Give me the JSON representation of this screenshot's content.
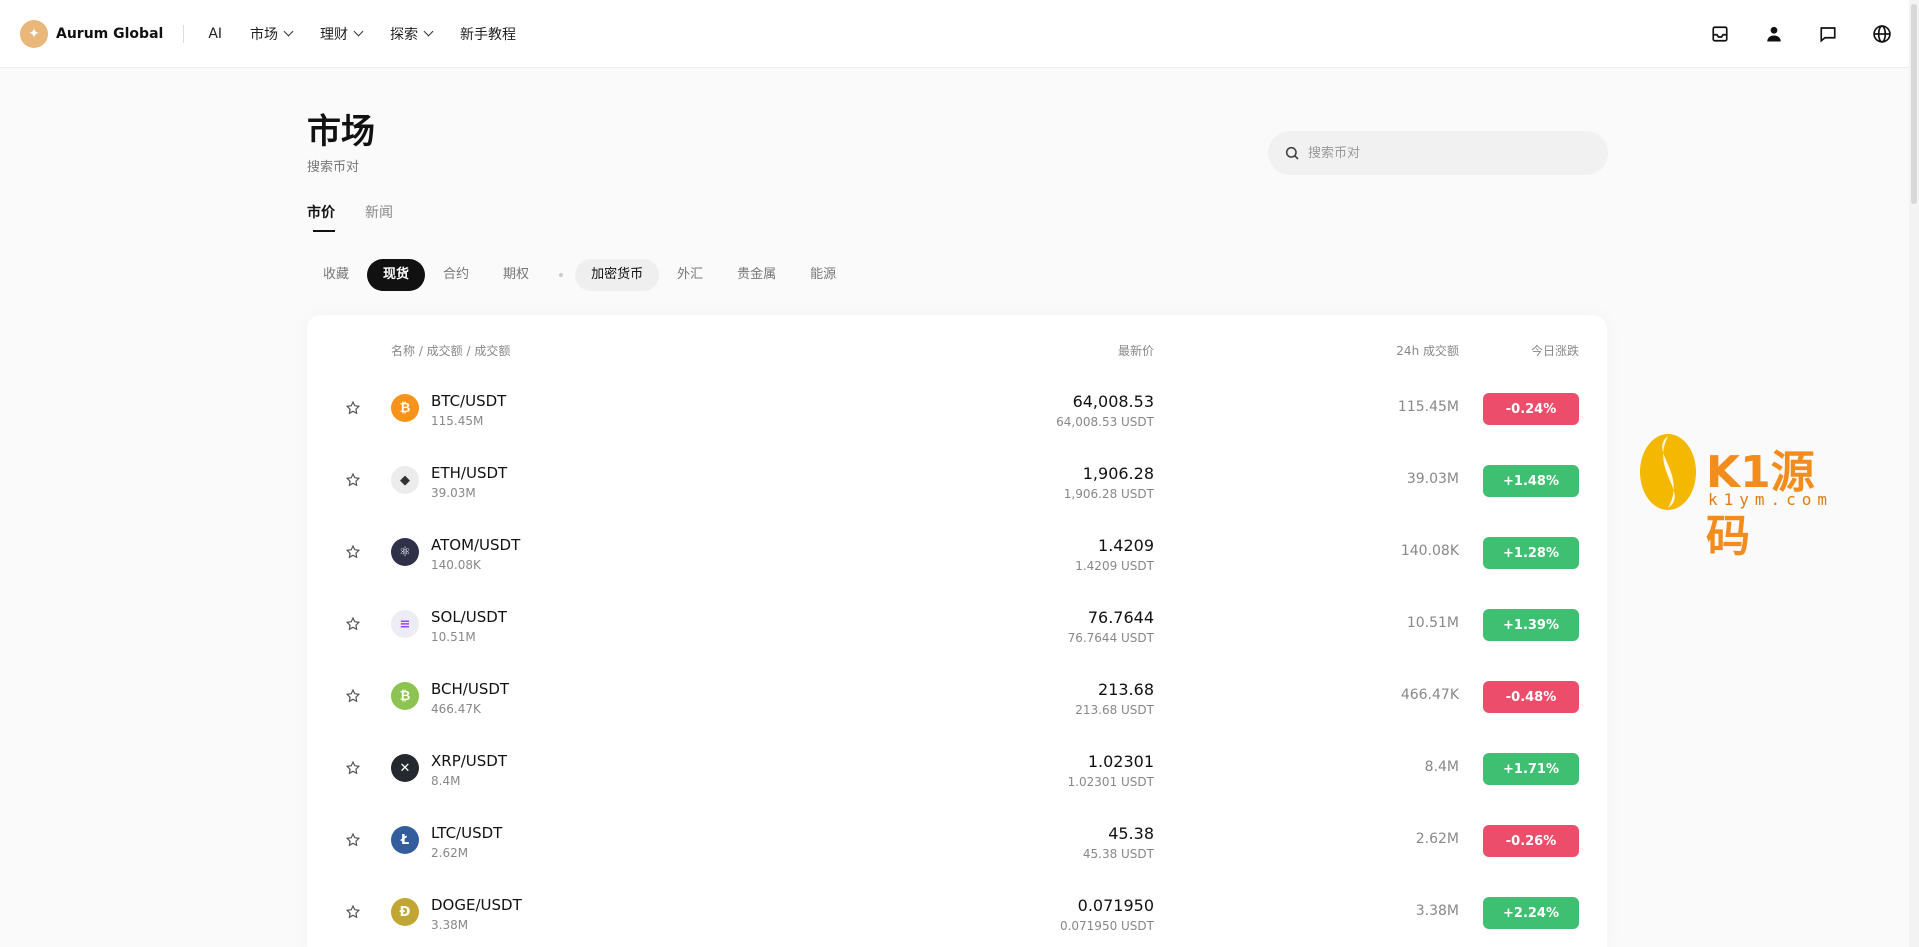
{
  "brand": {
    "name": "Aurum Global",
    "logo_glyph": "✦",
    "logo_color": "#e9b77a"
  },
  "nav": [
    {
      "label": "AI",
      "dropdown": false
    },
    {
      "label": "市场",
      "dropdown": true
    },
    {
      "label": "理财",
      "dropdown": true
    },
    {
      "label": "探索",
      "dropdown": true
    },
    {
      "label": "新手教程",
      "dropdown": false
    }
  ],
  "top_icons": [
    "inbox-icon",
    "user-icon",
    "chat-icon",
    "globe-icon"
  ],
  "page": {
    "title": "市场",
    "subtitle": "搜索币对"
  },
  "search": {
    "placeholder": "搜索币对"
  },
  "tabs": [
    {
      "label": "市价",
      "active": true
    },
    {
      "label": "新闻",
      "active": false
    }
  ],
  "chips_group1": [
    {
      "label": "收藏",
      "state": "none"
    },
    {
      "label": "现货",
      "state": "black"
    },
    {
      "label": "合约",
      "state": "none"
    },
    {
      "label": "期权",
      "state": "none"
    }
  ],
  "chips_group2": [
    {
      "label": "加密货币",
      "state": "grey"
    },
    {
      "label": "外汇",
      "state": "none"
    },
    {
      "label": "贵金属",
      "state": "none"
    },
    {
      "label": "能源",
      "state": "none"
    }
  ],
  "table": {
    "headers": {
      "name": "名称 / 成交额 / 成交额",
      "price": "最新价",
      "volume": "24h 成交额",
      "change": "今日涨跌"
    },
    "rows": [
      {
        "pair": "BTC/USDT",
        "sub": "115.45M",
        "price": "64,008.53",
        "price_sub": "64,008.53 USDT",
        "volume": "115.45M",
        "change": "-0.24%",
        "dir": "down",
        "coin": "btc-icon",
        "coin_color": "#f7931a",
        "coin_glyph": "₿"
      },
      {
        "pair": "ETH/USDT",
        "sub": "39.03M",
        "price": "1,906.28",
        "price_sub": "1,906.28 USDT",
        "volume": "39.03M",
        "change": "+1.48%",
        "dir": "up",
        "coin": "eth-icon",
        "coin_color": "#ececec",
        "coin_glyph": "◆"
      },
      {
        "pair": "ATOM/USDT",
        "sub": "140.08K",
        "price": "1.4209",
        "price_sub": "1.4209 USDT",
        "volume": "140.08K",
        "change": "+1.28%",
        "dir": "up",
        "coin": "atom-icon",
        "coin_color": "#2e3148",
        "coin_glyph": "⚛"
      },
      {
        "pair": "SOL/USDT",
        "sub": "10.51M",
        "price": "76.7644",
        "price_sub": "76.7644 USDT",
        "volume": "10.51M",
        "change": "+1.39%",
        "dir": "up",
        "coin": "sol-icon",
        "coin_color": "#ececf4",
        "coin_glyph": "≡"
      },
      {
        "pair": "BCH/USDT",
        "sub": "466.47K",
        "price": "213.68",
        "price_sub": "213.68 USDT",
        "volume": "466.47K",
        "change": "-0.48%",
        "dir": "down",
        "coin": "bch-icon",
        "coin_color": "#8dc351",
        "coin_glyph": "₿"
      },
      {
        "pair": "XRP/USDT",
        "sub": "8.4M",
        "price": "1.02301",
        "price_sub": "1.02301 USDT",
        "volume": "8.4M",
        "change": "+1.71%",
        "dir": "up",
        "coin": "xrp-icon",
        "coin_color": "#23292f",
        "coin_glyph": "✕"
      },
      {
        "pair": "LTC/USDT",
        "sub": "2.62M",
        "price": "45.38",
        "price_sub": "45.38 USDT",
        "volume": "2.62M",
        "change": "-0.26%",
        "dir": "down",
        "coin": "ltc-icon",
        "coin_color": "#345d9d",
        "coin_glyph": "Ł"
      },
      {
        "pair": "DOGE/USDT",
        "sub": "3.38M",
        "price": "0.071950",
        "price_sub": "0.071950 USDT",
        "volume": "3.38M",
        "change": "+2.24%",
        "dir": "up",
        "coin": "doge-icon",
        "coin_color": "#c2a633",
        "coin_glyph": "Ð"
      }
    ]
  },
  "colors": {
    "up": "#3fbf72",
    "down": "#eb4d6b",
    "accent": "#111111"
  },
  "watermark": {
    "text": "K1源码",
    "sub": "k1ym.com"
  }
}
